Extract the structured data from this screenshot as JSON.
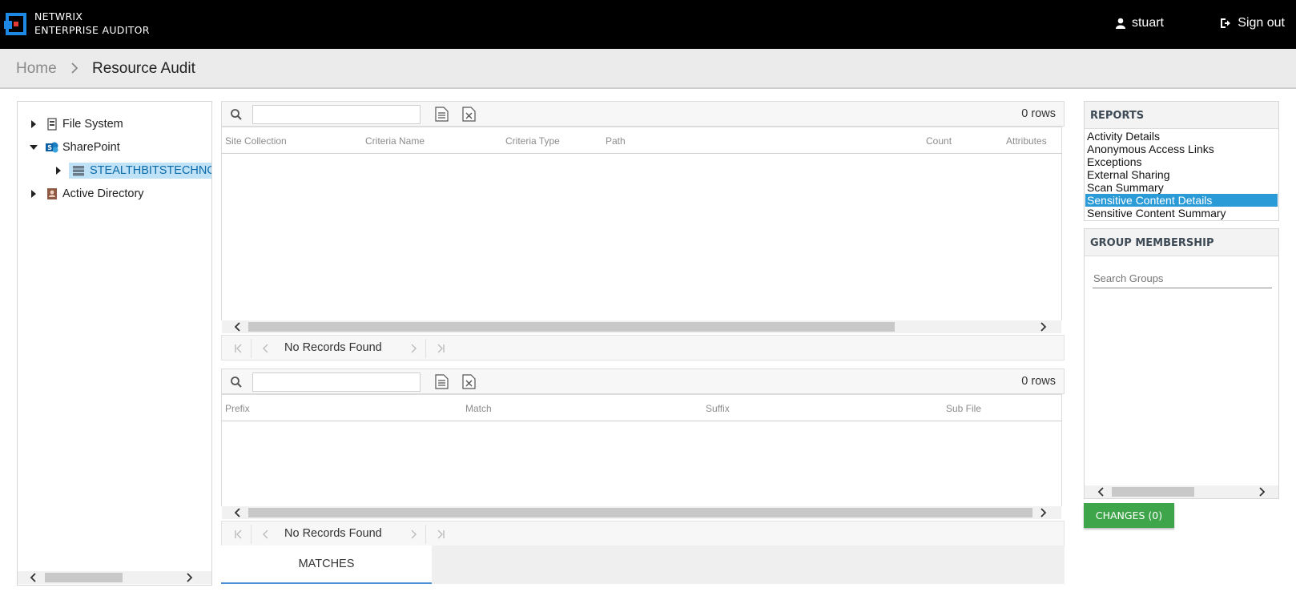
{
  "header": {
    "brand_line1": "NETWRIX",
    "brand_line2": "ENTERPRISE AUDITOR",
    "user_name": "stuart",
    "signout_label": "Sign out"
  },
  "breadcrumb": {
    "home": "Home",
    "current": "Resource Audit"
  },
  "tree": {
    "items": [
      {
        "label": "File System",
        "icon": "file-server-icon",
        "expanded": false
      },
      {
        "label": "SharePoint",
        "icon": "sharepoint-icon",
        "expanded": true
      },
      {
        "label": "STEALTHBITSTECHNO",
        "icon": "server-icon",
        "expanded": false,
        "selected": true
      },
      {
        "label": "Active Directory",
        "icon": "active-directory-icon",
        "expanded": false
      }
    ]
  },
  "grid_top": {
    "search_value": "",
    "rows_label": "0 rows",
    "columns": [
      "Site Collection",
      "Criteria Name",
      "Criteria Type",
      "Path",
      "Count",
      "Attributes"
    ],
    "pager_text": "No Records Found"
  },
  "grid_bottom": {
    "search_value": "",
    "rows_label": "0 rows",
    "columns": [
      "Prefix",
      "Match",
      "Suffix",
      "Sub File"
    ],
    "pager_text": "No Records Found"
  },
  "tabs": {
    "matches": "MATCHES"
  },
  "reports": {
    "title": "REPORTS",
    "items": [
      "Activity Details",
      "Anonymous Access Links",
      "Exceptions",
      "External Sharing",
      "Scan Summary",
      "Sensitive Content Details",
      "Sensitive Content Summary"
    ],
    "selected": "Sensitive Content Details"
  },
  "groups": {
    "title": "GROUP MEMBERSHIP",
    "search_placeholder": "Search Groups"
  },
  "changes_button": "CHANGES (0)",
  "colors": {
    "header_bg": "#000000",
    "accent_blue": "#2b9bd8",
    "changes_green": "#3fa54a",
    "logo_blue": "#1e88e5",
    "logo_red": "#e53935"
  }
}
